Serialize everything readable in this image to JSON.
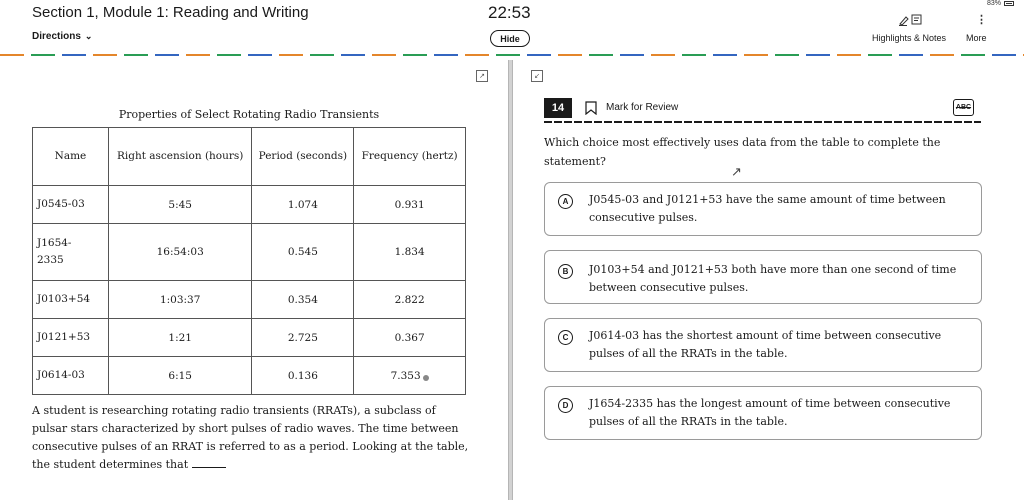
{
  "header": {
    "section_title": "Section 1, Module 1: Reading and Writing",
    "directions_label": "Directions",
    "timer": "22:53",
    "hide_label": "Hide",
    "battery": "83%",
    "highlights_label": "Highlights & Notes",
    "more_label": "More"
  },
  "table": {
    "title": "Properties of Select Rotating Radio Transients",
    "headers": [
      "Name",
      "Right ascension (hours)",
      "Period (seconds)",
      "Frequency (hertz)"
    ],
    "rows": [
      {
        "name": "J0545-03",
        "ra": "5:45",
        "period": "1.074",
        "frequency": "0.931"
      },
      {
        "name": "J1654-2335",
        "ra": "16:54:03",
        "period": "0.545",
        "frequency": "1.834"
      },
      {
        "name": "J0103+54",
        "ra": "1:03:37",
        "period": "0.354",
        "frequency": "2.822"
      },
      {
        "name": "J0121+53",
        "ra": "1:21",
        "period": "2.725",
        "frequency": "0.367"
      },
      {
        "name": "J0614-03",
        "ra": "6:15",
        "period": "0.136",
        "frequency": "7.353"
      }
    ]
  },
  "passage": "A student is researching rotating radio transients (RRATs), a subclass of pulsar stars characterized by short pulses of radio waves. The time between consecutive pulses of an RRAT is referred to as a period. Looking at the table, the student determines that",
  "question": {
    "number": "14",
    "mark_label": "Mark for Review",
    "abc_label": "ABC",
    "stem": "Which choice most effectively uses data from the table to complete the statement?",
    "choices": [
      {
        "letter": "A",
        "text": "J0545-03 and J0121+53 have the same amount of time between consecutive pulses."
      },
      {
        "letter": "B",
        "text": "J0103+54 and J0121+53 both have more than one second of time between consecutive pulses."
      },
      {
        "letter": "C",
        "text": "J0614-03 has the shortest amount of time between consecutive pulses of all the RRATs in the table."
      },
      {
        "letter": "D",
        "text": "J1654-2335 has the longest amount of time between consecutive pulses of all the RRATs in the table."
      }
    ]
  }
}
